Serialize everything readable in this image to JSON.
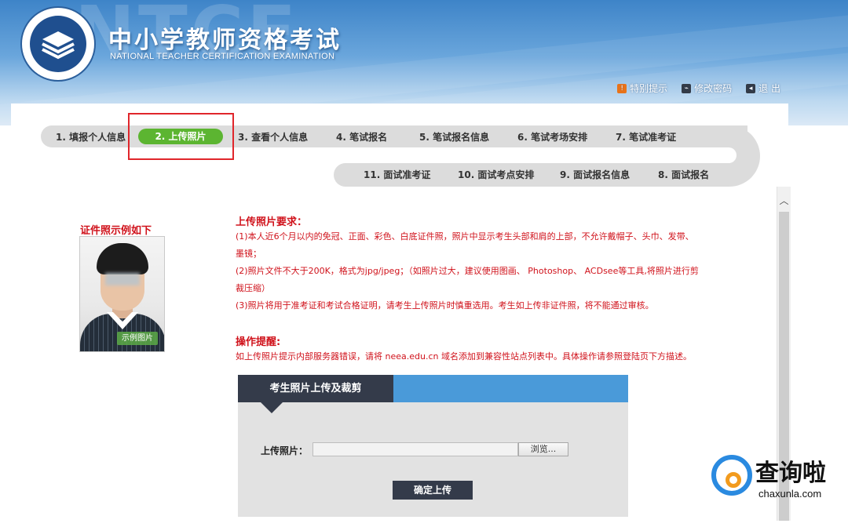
{
  "header": {
    "title_cn": "中小学教师资格考试",
    "title_en": "NATIONAL TEACHER CERTIFICATION EXAMINATION",
    "watermark": "NTCE",
    "links": [
      "特别提示",
      "修改密码",
      "退 出"
    ]
  },
  "nav": {
    "row1": [
      "1. 填报个人信息",
      "2. 上传照片",
      "3. 查看个人信息",
      "4. 笔试报名",
      "5. 笔试报名信息",
      "6. 笔试考场安排",
      "7. 笔试准考证"
    ],
    "row2": [
      "11. 面试准考证",
      "10. 面试考点安排",
      "9. 面试报名信息",
      "8. 面试报名"
    ],
    "active": "2. 上传照片"
  },
  "sample": {
    "title": "证件照示例如下",
    "badge": "示例图片"
  },
  "requirements": {
    "title": "上传照片要求：",
    "lines": [
      "(1)本人近6个月以内的免冠、正面、彩色、白底证件照，照片中显示考生头部和肩的上部，不允许戴帽子、头巾、发带、",
      "墨镜；",
      "(2)照片文件不大于200K，格式为jpg/jpeg；（如照片过大，建议使用图画、 Photoshop、 ACDsee等工具,将照片进行剪",
      "裁压缩）",
      "(3)照片将用于准考证和考试合格证明，请考生上传照片时慎重选用。考生如上传非证件照，将不能通过审核。"
    ]
  },
  "operation": {
    "title": "操作提醒:",
    "text": "如上传照片提示内部服务器错误，请将 neea.edu.cn 域名添加到兼容性站点列表中。具体操作请参照登陆页下方描述。"
  },
  "upload_panel": {
    "tab_title": "考生照片上传及裁剪",
    "label": "上传照片：",
    "browse": "浏览...",
    "confirm": "确定上传"
  },
  "watermark": {
    "cn": "查询啦",
    "en": "chaxunla.com"
  }
}
